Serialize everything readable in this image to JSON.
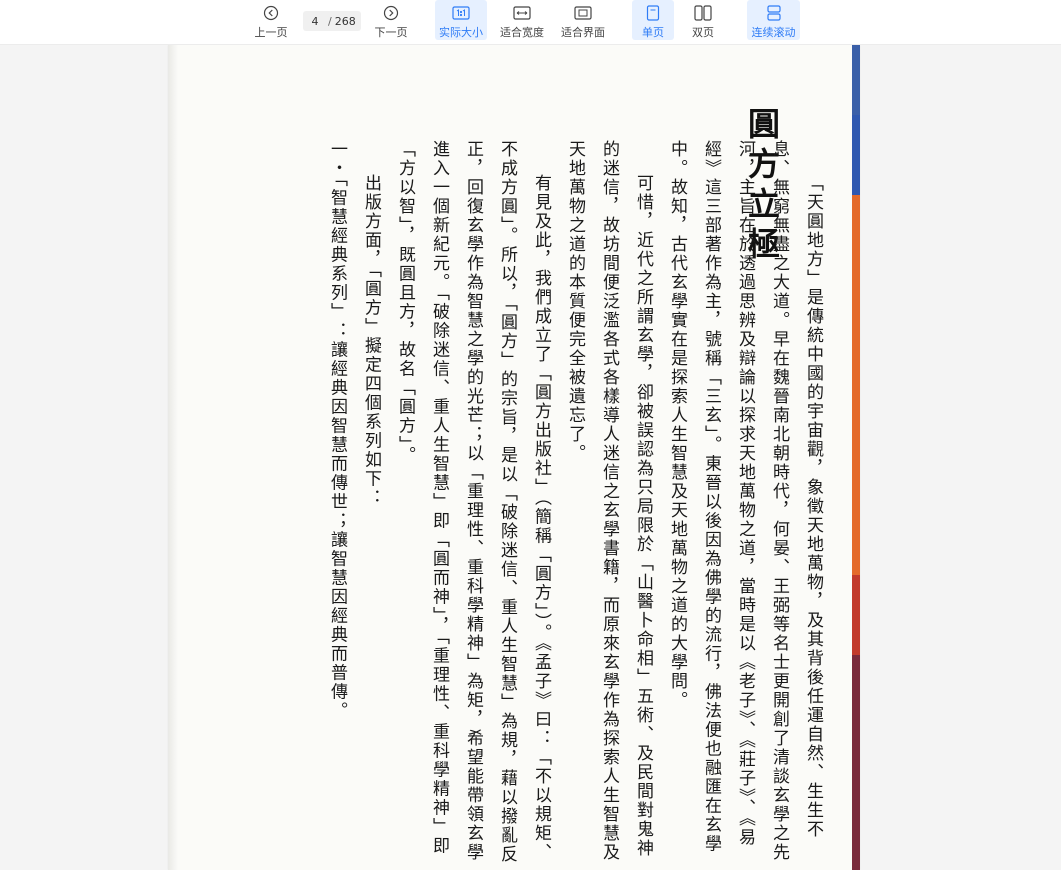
{
  "toolbar": {
    "prev_label": "上一页",
    "next_label": "下一页",
    "page_current": "4",
    "page_sep": "/",
    "page_total": "268",
    "actual_size_label": "实际大小",
    "fit_width_label": "适合宽度",
    "fit_page_label": "适合界面",
    "single_page_label": "单页",
    "double_page_label": "双页",
    "continuous_label": "连续滚动",
    "accent_color": "#2f7cf6"
  },
  "document": {
    "title": "圓方立極",
    "paragraphs": [
      "「天圓地方」是傳統中國的宇宙觀，象徵天地萬物，及其背後任運自然、生生不息、無窮無盡之大道。早在魏晉南北朝時代，何晏、王弼等名士更開創了清談玄學之先河，主旨在於透過思辨及辯論以探求天地萬物之道，當時是以《老子》、《莊子》、《易經》這三部著作為主，號稱「三玄」。東晉以後因為佛學的流行，佛法便也融匯在玄學中。故知，古代玄學實在是探索人生智慧及天地萬物之道的大學問。",
      "可惜，近代之所謂玄學，卻被誤認為只局限於「山醫卜命相」五術、及民間對鬼神的迷信，故坊間便泛濫各式各樣導人迷信之玄學書籍，而原來玄學作為探索人生智慧及天地萬物之道的本質便完全被遺忘了。",
      "有見及此，我們成立了「圓方出版社」（簡稱「圓方」）。《孟子》曰：「不以規矩、不成方圓」。所以，「圓方」的宗旨，是以「破除迷信、重人生智慧」為規，藉以撥亂反正，回復玄學作為智慧之學的光芒；以「重理性、重科學精神」為矩，希望能帶領玄學進入一個新紀元。「破除迷信、重人生智慧」即「圓而神」，「重理性、重科學精神」即「方以智」，既圓且方，故名「圓方」。",
      "出版方面，「圓方」擬定四個系列如下：",
      "一・「智慧經典系列」：讓經典因智慧而傳世；讓智慧因經典而普傳。"
    ]
  }
}
